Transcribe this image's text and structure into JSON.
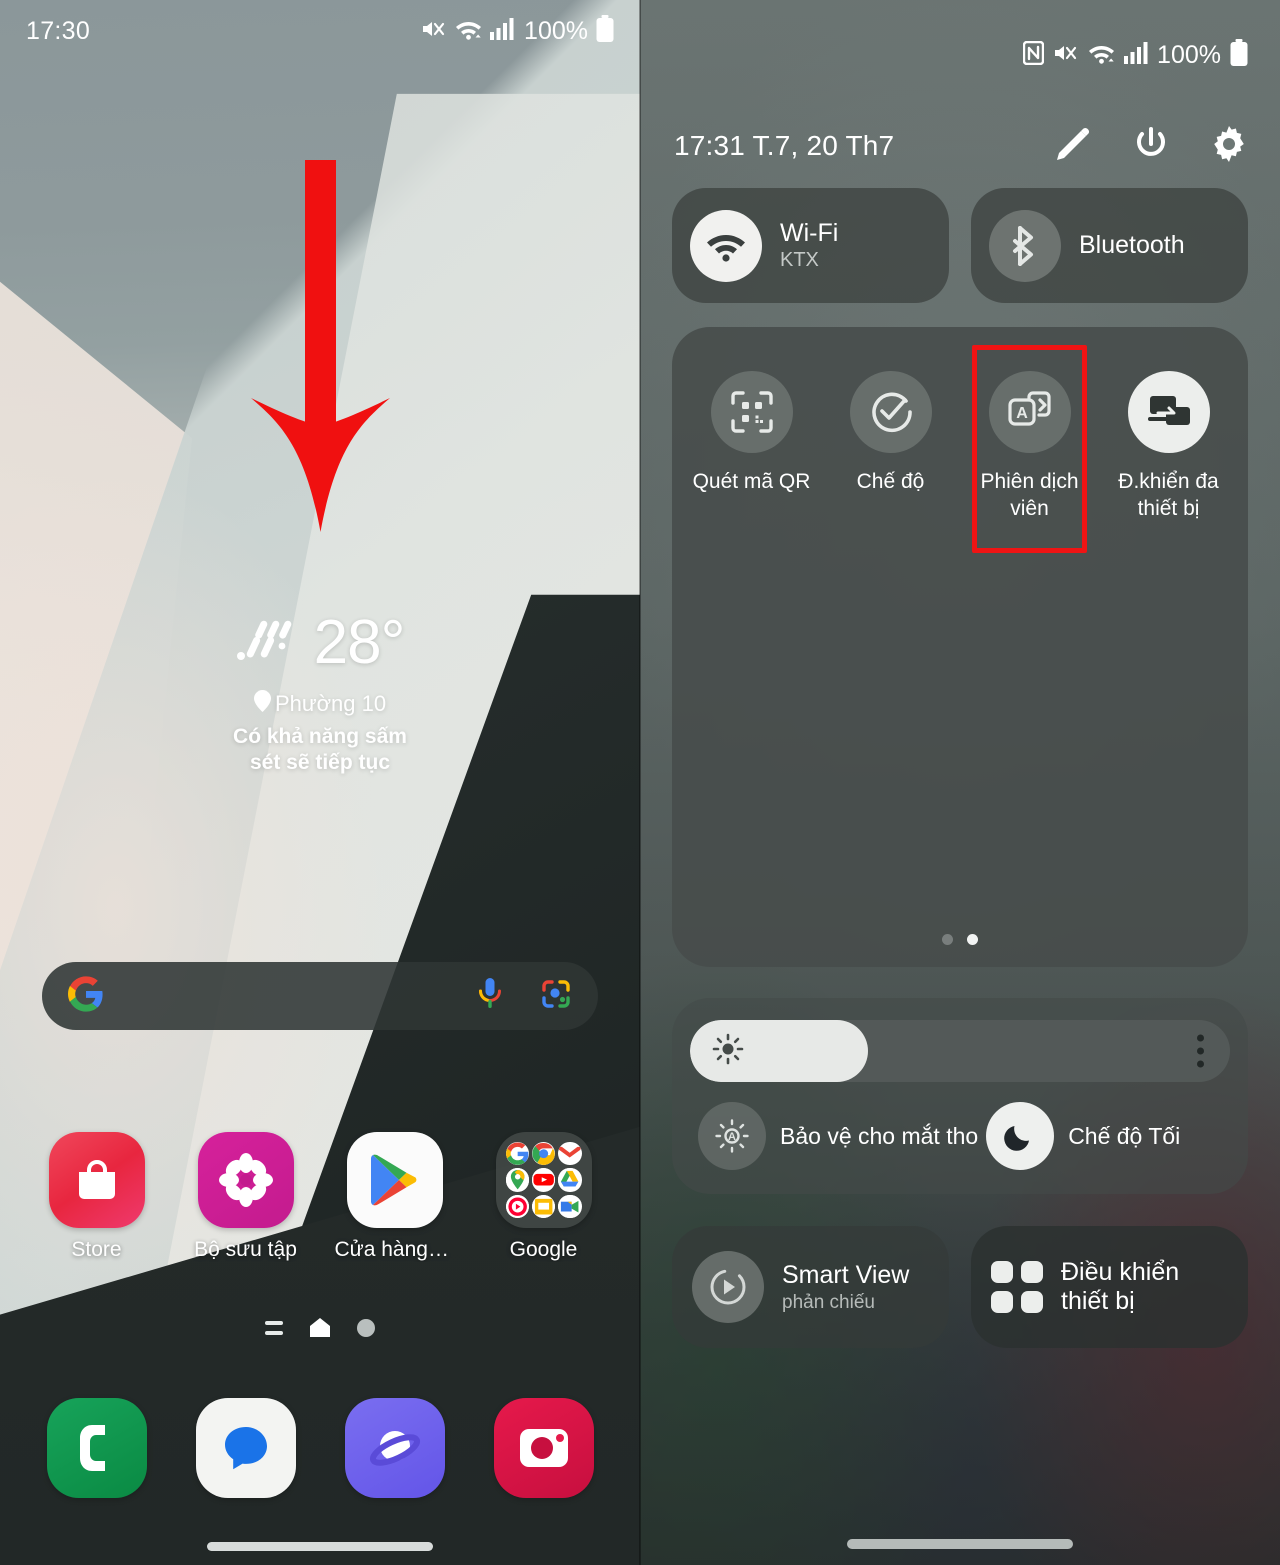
{
  "left_phone": {
    "status_bar": {
      "time": "17:30",
      "battery_percent": "100%",
      "icons": [
        "mute-icon",
        "wifi-icon",
        "signal-icon",
        "battery-icon"
      ]
    },
    "weather_widget": {
      "temperature": "28°",
      "icon": "rain-icon",
      "location": "Phường 10",
      "location_icon": "location-pin-icon",
      "description_line1": "Có khả năng sấm",
      "description_line2": "sét sẽ tiếp tục"
    },
    "search_bar": {
      "logo": "google-g-icon",
      "mic_icon": "microphone-icon",
      "lens_icon": "google-lens-icon"
    },
    "apps": [
      {
        "label": "Store",
        "icon": "galaxy-store-icon"
      },
      {
        "label": "Bộ sưu tập",
        "icon": "gallery-icon"
      },
      {
        "label": "Cửa hàng Play",
        "icon": "play-store-icon"
      },
      {
        "label": "Google",
        "icon": "google-folder-icon"
      }
    ],
    "page_indicators": {
      "lines_icon": "app-list-icon",
      "home_icon": "home-icon",
      "dot_icon": "page-dot-icon"
    },
    "dock": [
      {
        "label": "Phone",
        "icon": "phone-icon"
      },
      {
        "label": "Messages",
        "icon": "messages-icon"
      },
      {
        "label": "Samsung Internet",
        "icon": "internet-icon"
      },
      {
        "label": "Camera",
        "icon": "camera-icon"
      }
    ],
    "annotation": {
      "type": "arrow",
      "direction": "down",
      "color": "#F01010"
    }
  },
  "right_phone": {
    "status_bar": {
      "battery_percent": "100%",
      "icons": [
        "nfc-icon",
        "mute-icon",
        "wifi-icon",
        "signal-icon",
        "battery-icon"
      ]
    },
    "header": {
      "datetime": "17:31  T.7, 20 Th7",
      "edit_icon": "pencil-icon",
      "power_icon": "power-icon",
      "settings_icon": "gear-icon"
    },
    "connectivity_tiles": [
      {
        "title": "Wi-Fi",
        "subtitle": "KTX",
        "icon": "wifi-icon",
        "active": true
      },
      {
        "title": "Bluetooth",
        "subtitle": "",
        "icon": "bluetooth-icon",
        "active": false
      }
    ],
    "quick_tiles": [
      {
        "label": "Quét mã QR",
        "icon": "qr-scan-icon",
        "active": false,
        "highlighted": false
      },
      {
        "label": "Chế độ",
        "icon": "modes-check-icon",
        "active": false,
        "highlighted": false
      },
      {
        "label": "Phiên dịch\nviên",
        "label_line1": "Phiên dịch",
        "label_line2": "viên",
        "icon": "interpreter-translate-icon",
        "active": false,
        "highlighted": true
      },
      {
        "label_line1": "Đ.khiển đa",
        "label_line2": "thiết bị",
        "icon": "multi-device-control-icon",
        "active": true,
        "highlighted": false
      }
    ],
    "page_dots": {
      "count": 2,
      "active_index": 1
    },
    "brightness": {
      "percent": 33,
      "sun_icon": "brightness-sun-icon",
      "more_icon": "more-vertical-icon"
    },
    "display_options": [
      {
        "label": "Bảo vệ cho mắt tho",
        "icon": "eye-comfort-icon",
        "active": false
      },
      {
        "label": "Chế độ Tối",
        "icon": "moon-icon",
        "active": true
      }
    ],
    "bottom_tiles": [
      {
        "title": "Smart View",
        "subtitle": "phản chiếu",
        "icon": "smart-view-icon"
      },
      {
        "title": "Điều khiển thiết bị",
        "subtitle": "",
        "icon": "device-control-grid-icon"
      }
    ]
  },
  "colors": {
    "highlight_red": "#EF1414",
    "arrow_red": "#F01010",
    "panel_bg": "#474D4B",
    "tile_bg": "#424846",
    "active_white": "#ECEEEC"
  }
}
